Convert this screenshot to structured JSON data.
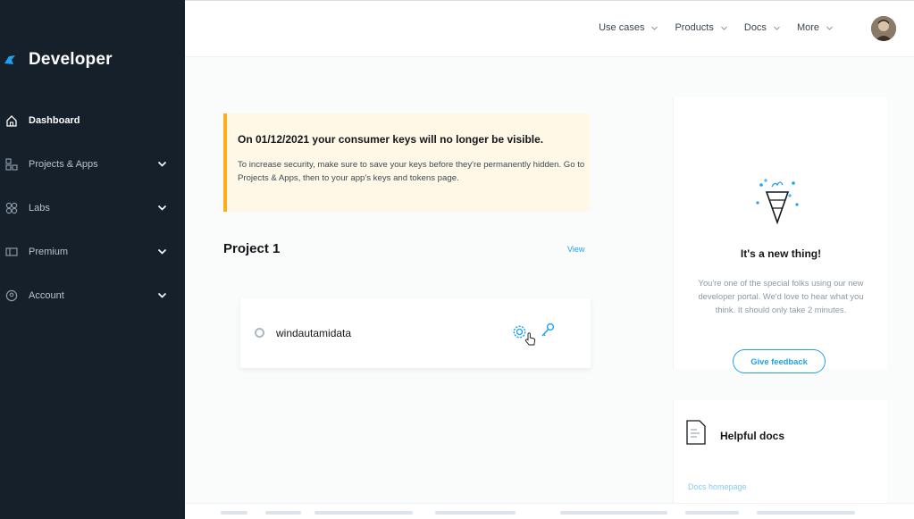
{
  "brand": {
    "title": "Developer"
  },
  "sidebar": {
    "items": [
      {
        "label": "Dashboard",
        "icon": "home-icon",
        "active": true
      },
      {
        "label": "Projects & Apps",
        "icon": "projects-icon",
        "expandable": true
      },
      {
        "label": "Labs",
        "icon": "labs-icon",
        "expandable": true
      },
      {
        "label": "Premium",
        "icon": "premium-icon",
        "expandable": true
      },
      {
        "label": "Account",
        "icon": "account-icon",
        "expandable": true
      }
    ]
  },
  "topnav": {
    "items": [
      {
        "label": "Use cases"
      },
      {
        "label": "Products"
      },
      {
        "label": "Docs"
      },
      {
        "label": "More"
      }
    ]
  },
  "alert": {
    "title": "On 01/12/2021 your consumer keys will no longer be visible.",
    "body": "To increase security, make sure to save your keys before they're permanently hidden. Go to Projects & Apps, then to your app's keys and tokens page."
  },
  "project": {
    "title": "Project 1",
    "view_label": "View",
    "app": {
      "name": "windautamidata"
    }
  },
  "promo": {
    "title": "It's a new thing!",
    "body": "You're one of the special folks using our new developer portal. We'd love to hear what you think. It should only take 2 minutes.",
    "button_label": "Give feedback"
  },
  "helpful": {
    "title": "Helpful docs",
    "link": "Docs homepage"
  },
  "colors": {
    "sidebar_bg": "#15202b",
    "accent": "#1da1f2",
    "alert_bg": "#fff8e6",
    "alert_border": "#ffad1f"
  }
}
